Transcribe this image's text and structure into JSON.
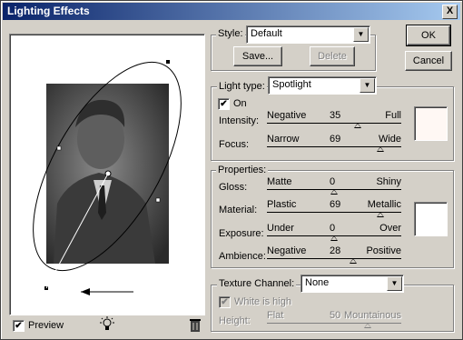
{
  "window": {
    "title": "Lighting Effects",
    "close_glyph": "X"
  },
  "buttons": {
    "ok": "OK",
    "cancel": "Cancel",
    "save": "Save...",
    "delete": "Delete"
  },
  "style": {
    "label": "Style:",
    "value": "Default"
  },
  "light": {
    "type_label": "Light type:",
    "type_value": "Spotlight",
    "on_label": "On",
    "on_checked": true,
    "intensity": {
      "label": "Intensity:",
      "left": "Negative",
      "value": "35",
      "right": "Full",
      "level": 0.675
    },
    "focus": {
      "label": "Focus:",
      "left": "Narrow",
      "value": "69",
      "right": "Wide",
      "level": 0.845
    },
    "color": "#fff8f4"
  },
  "properties": {
    "title": "Properties:",
    "gloss": {
      "label": "Gloss:",
      "left": "Matte",
      "value": "0",
      "right": "Shiny",
      "level": 0.5
    },
    "material": {
      "label": "Material:",
      "left": "Plastic",
      "value": "69",
      "right": "Metallic",
      "level": 0.845
    },
    "exposure": {
      "label": "Exposure:",
      "left": "Under",
      "value": "0",
      "right": "Over",
      "level": 0.5
    },
    "ambience": {
      "label": "Ambience:",
      "left": "Negative",
      "value": "28",
      "right": "Positive",
      "level": 0.64
    },
    "color": "#ffffff"
  },
  "texture": {
    "label": "Texture Channel:",
    "value": "None",
    "white_is_high_label": "White is high",
    "white_is_high_checked": true,
    "height": {
      "label": "Height:",
      "left": "Flat",
      "value": "50",
      "right": "Mountainous",
      "level": 0.75
    }
  },
  "preview": {
    "label": "Preview",
    "checked": true
  }
}
